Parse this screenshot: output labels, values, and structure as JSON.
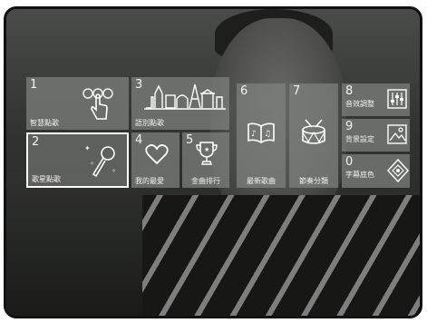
{
  "menu": {
    "tiles": [
      {
        "num": "1",
        "label": "智慧點歌"
      },
      {
        "num": "2",
        "label": "歌星點歌"
      },
      {
        "num": "3",
        "label": "語別點歌"
      },
      {
        "num": "4",
        "label": "我的最愛"
      },
      {
        "num": "5",
        "label": "金曲排行"
      },
      {
        "num": "6",
        "label": "最新歌曲"
      },
      {
        "num": "7",
        "label": "節奏分類"
      },
      {
        "num": "8",
        "label": "音效調整"
      },
      {
        "num": "9",
        "label": "背景設定"
      },
      {
        "num": "0",
        "label": "字幕底色"
      }
    ],
    "selected_num": "2"
  },
  "icons": {
    "tile1": "touch-hand-icon",
    "tile2": "microphone-stars-icon",
    "tile3": "world-landmarks-icon",
    "tile4": "heart-icon",
    "tile5": "trophy-icon",
    "tile6": "music-book-icon",
    "tile7": "drum-icon",
    "tile8": "equalizer-icon",
    "tile9": "picture-icon",
    "tile0": "color-diamond-icon"
  }
}
